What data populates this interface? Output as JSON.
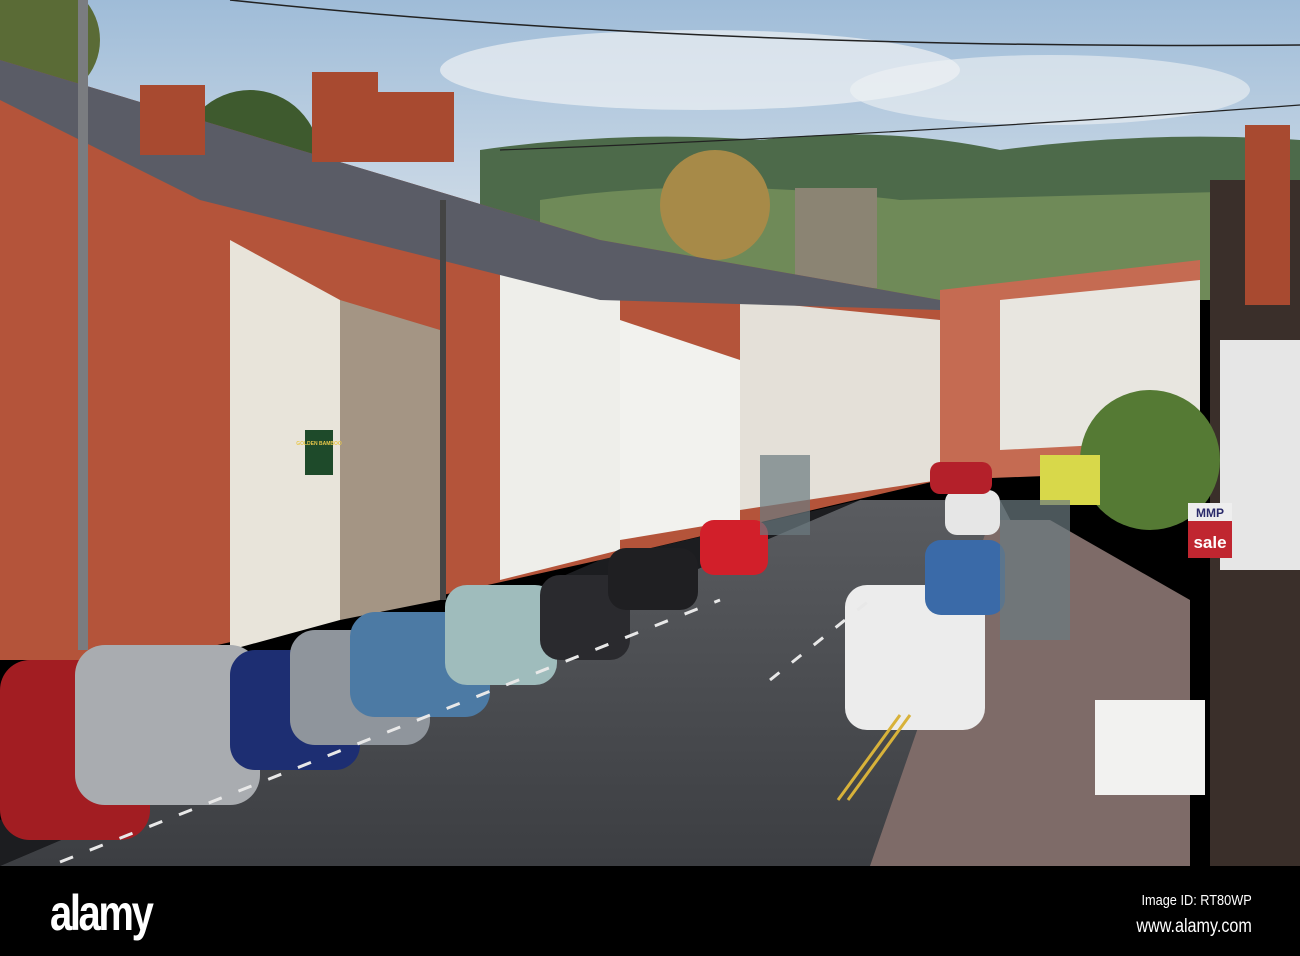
{
  "photo": {
    "signs": {
      "restaurant": "GOLDEN BAMBOO",
      "estate_agent": "MMP",
      "for_sale": "sale"
    }
  },
  "footer": {
    "logo": "alamy",
    "image_id": "Image ID: RT80WP",
    "website": "www.alamy.com"
  },
  "colors": {
    "sky": "#b9cde0",
    "brick": "#b4543a",
    "road": "#4a4c50",
    "footer": "#000000"
  }
}
